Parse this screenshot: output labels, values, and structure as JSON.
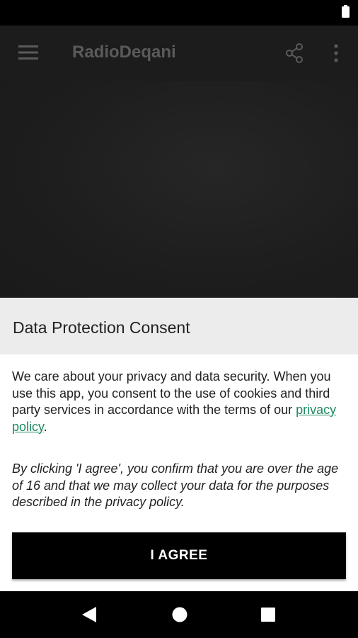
{
  "app_bar": {
    "title": "RadioDeqani",
    "icons": [
      "menu-icon",
      "share-icon",
      "more-vert-icon"
    ]
  },
  "status_bar": {
    "icons": [
      "battery-icon"
    ]
  },
  "consent": {
    "title": "Data Protection Consent",
    "body_before_link": "We care about your privacy and data security. When you use this app, you consent to the use of cookies and third party services in accordance with the terms of our ",
    "link_text": "privacy policy",
    "body_after_link": ".",
    "italic_text": "By clicking 'I agree', you confirm that you are over the age of 16 and that we may collect your data for the purposes described in the privacy policy.",
    "agree_label": "I AGREE"
  },
  "nav_bar": {
    "icons": [
      "back-icon",
      "home-icon",
      "recents-icon"
    ]
  },
  "colors": {
    "link": "#1e8a5f",
    "button_bg": "#000000",
    "header_bg": "#ececec",
    "app_bar_bg": "#1c1c1c"
  }
}
